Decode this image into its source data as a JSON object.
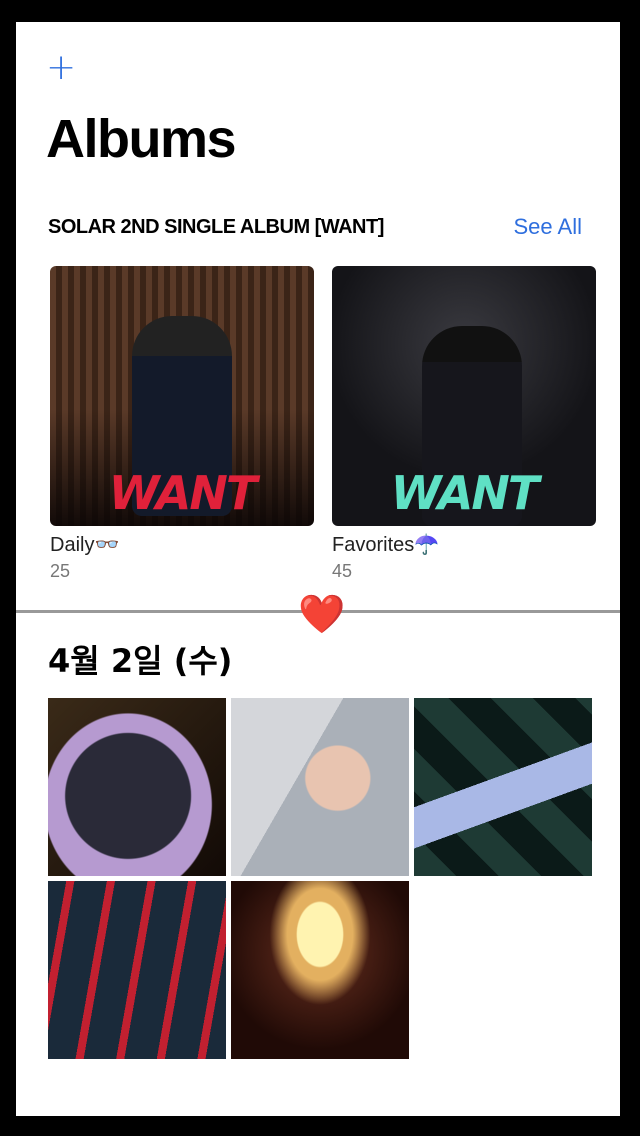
{
  "header": {
    "add_icon": "plus-icon",
    "title": "Albums"
  },
  "section": {
    "title": "SOLAR 2ND SINGLE ALBUM [WANT]",
    "see_all": "See All"
  },
  "albums": [
    {
      "name": "Daily👓",
      "count": "25",
      "cover_text": "WANT"
    },
    {
      "name": "Favorites☂️",
      "count": "45",
      "cover_text": "WANT"
    }
  ],
  "divider": {
    "icon": "heart-icon",
    "glyph": "❤️"
  },
  "photos_section": {
    "date": "4월 2일 (수)"
  },
  "colors": {
    "accent": "#2f6fde",
    "want_red": "#e0213a",
    "want_mint": "#5fe0c4"
  }
}
